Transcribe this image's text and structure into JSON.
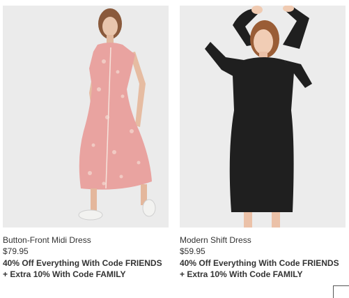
{
  "products": [
    {
      "name": "Button-Front Midi Dress",
      "price": "$79.95",
      "promo": "40% Off Everything With Code FRIENDS + Extra 10% With Code FAMILY",
      "image_color": "#e9a3a0"
    },
    {
      "name": "Modern Shift Dress",
      "price": "$59.95",
      "promo": "40% Off Everything With Code FRIENDS + Extra 10% With Code FAMILY",
      "image_color": "#1f1f1f"
    }
  ]
}
